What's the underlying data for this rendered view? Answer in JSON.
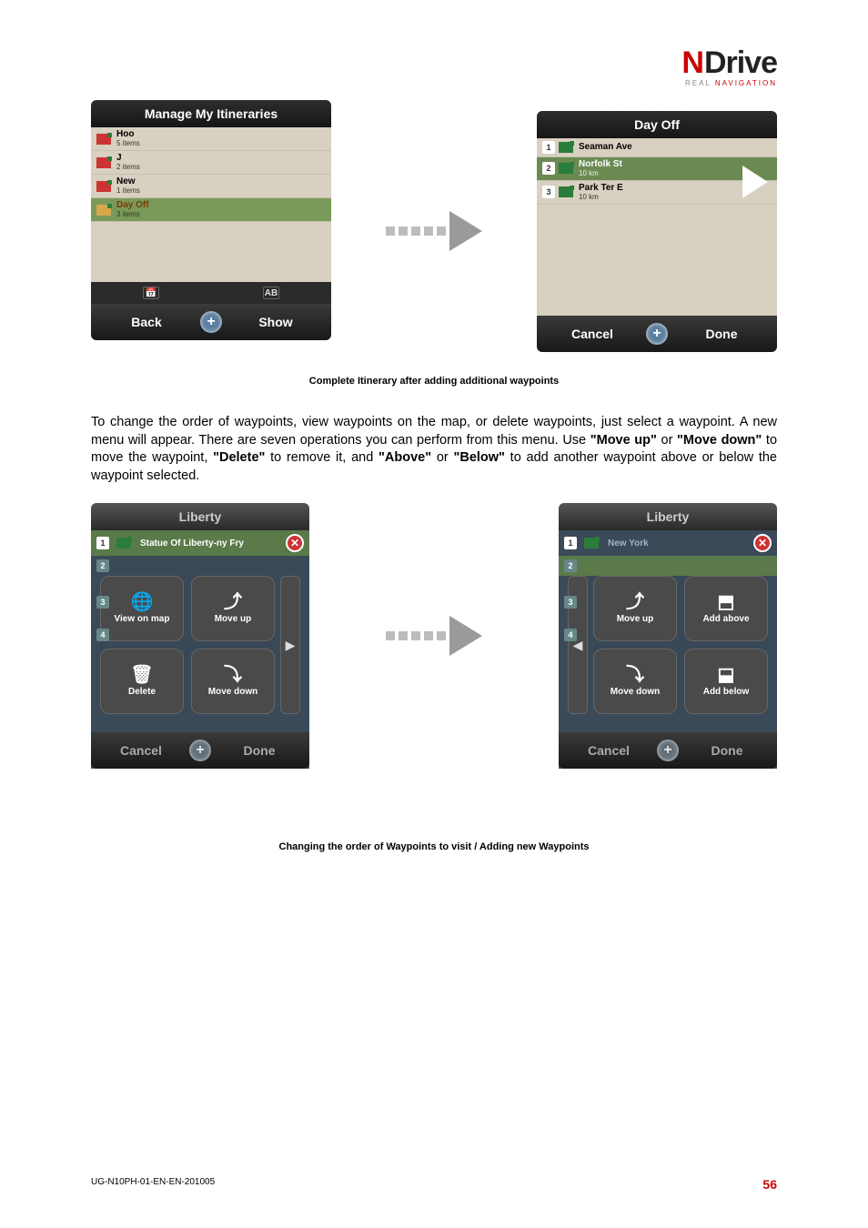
{
  "logo": {
    "n": "N",
    "drive": "Drive",
    "sub_real": "REAL ",
    "sub_nav": "NAVIGATION"
  },
  "fig1": {
    "left_header": "Manage My Itineraries",
    "left_items": [
      {
        "name": "Hoo",
        "sub": "5 items"
      },
      {
        "name": "J",
        "sub": "2 items"
      },
      {
        "name": "New",
        "sub": "1 items"
      },
      {
        "name": "Day Off",
        "sub": "3 items"
      }
    ],
    "left_sort_ab": "AB",
    "left_back": "Back",
    "left_show": "Show",
    "right_header": "Day Off",
    "right_items": [
      {
        "num": "1",
        "name": "Seaman Ave",
        "sub": ""
      },
      {
        "num": "2",
        "name": "Norfolk St",
        "sub": "10 km"
      },
      {
        "num": "3",
        "name": "Park Ter E",
        "sub": "10 km"
      }
    ],
    "right_cancel": "Cancel",
    "right_done": "Done",
    "caption": "Complete Itinerary after adding additional waypoints"
  },
  "paragraph": "To change the order of waypoints, view waypoints on the map, or delete waypoints, just select a waypoint. A new menu will appear. There are seven operations you can perform from this menu. Use \"Move up\" or \"Move down\" to move the waypoint, \"Delete\" to remove it, and \"Above\" or \"Below\" to add another waypoint above or below the waypoint selected.",
  "fig2": {
    "left_header": "Liberty",
    "left_wp1": "Statue Of Liberty-ny Fry",
    "ops_left": [
      "View on map",
      "Move up",
      "Delete",
      "Move down"
    ],
    "right_header": "Liberty",
    "right_wp1": "New York",
    "ops_right": [
      "Move up",
      "Add above",
      "Move down",
      "Add below"
    ],
    "cancel": "Cancel",
    "done": "Done",
    "wp_nums": [
      "1",
      "2",
      "3",
      "4"
    ],
    "caption": "Changing the order of Waypoints to visit / Adding new Waypoints"
  },
  "footer": {
    "doc": "UG-N10PH-01-EN-EN-201005",
    "page": "56"
  }
}
